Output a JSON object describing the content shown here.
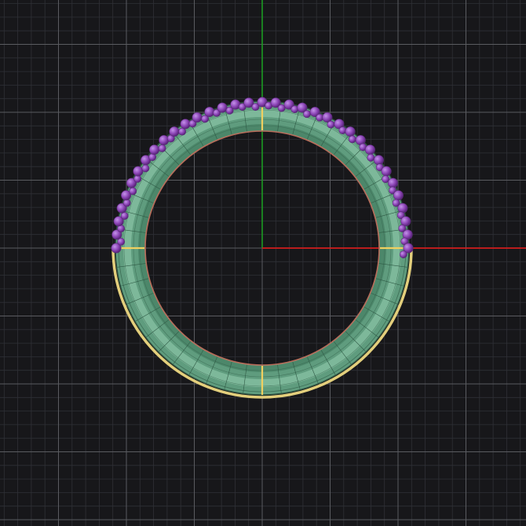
{
  "viewport": {
    "view": "top",
    "background_color": "#17171a",
    "grid_minor_color": "#2f3036",
    "grid_major_color": "#5a5b60",
    "axis_x_color": "#d21d1d",
    "axis_y_color": "#1c9a22",
    "grid_visible": true
  },
  "ring_model": {
    "band_color": "#6fae8e",
    "band_highlight_color": "#a9dcc0",
    "band_shadow_color": "#3f7a5e",
    "inner_edge_color": "#b86c5a",
    "outer_edge_selected_color": "#e3cf7c",
    "seam_color": "#f0d060",
    "gem_color": "#8c45b6",
    "gem_highlight_color": "#b57be0",
    "gem_setting": "pave-half-eternity"
  }
}
